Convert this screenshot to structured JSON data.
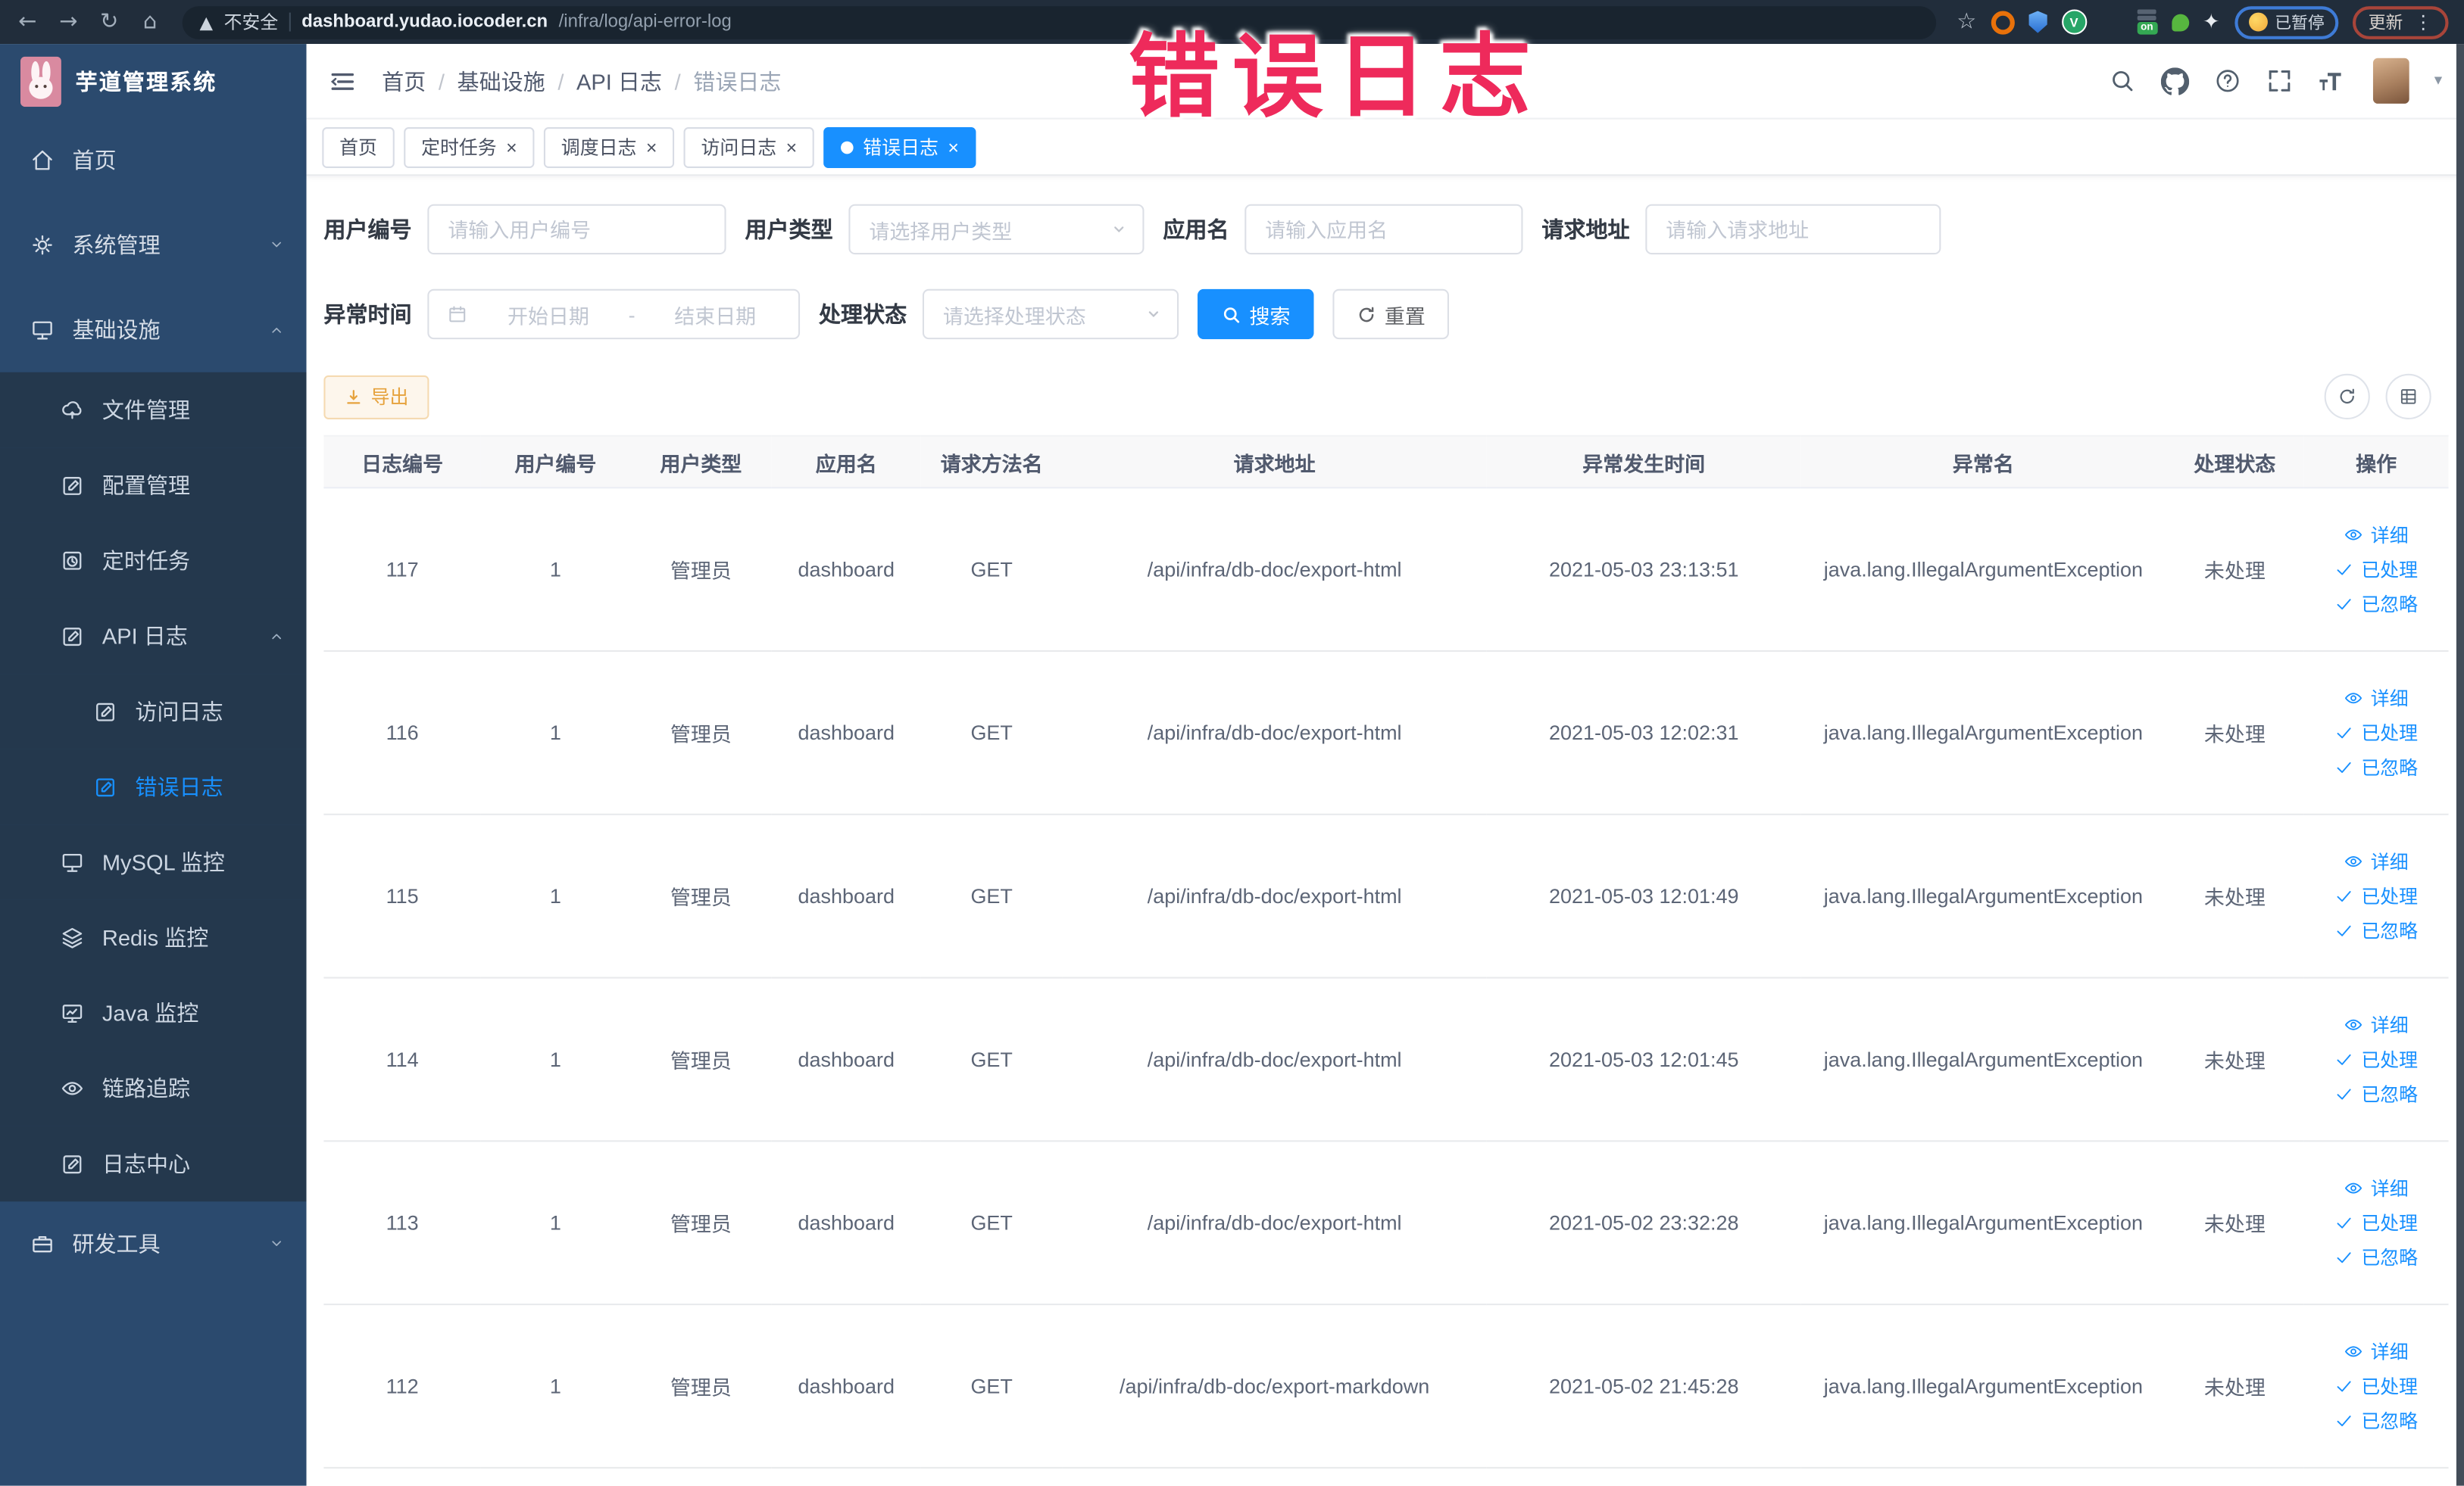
{
  "browser": {
    "security_label": "不安全",
    "url_host": "dashboard.yudao.iocoder.cn",
    "url_path": "/infra/log/api-error-log",
    "paused_badge_label": "已暂停",
    "update_badge_label": "更新"
  },
  "annotation_text": "错误日志",
  "sidebar": {
    "app_title": "芋道管理系统",
    "items": [
      {
        "label": "首页",
        "icon": "home-icon",
        "depth": 0
      },
      {
        "label": "系统管理",
        "icon": "gear-icon",
        "depth": 0,
        "chevron": "down"
      },
      {
        "label": "基础设施",
        "icon": "monitor-icon",
        "depth": 0,
        "chevron": "up"
      },
      {
        "label": "文件管理",
        "icon": "upload-cloud-icon",
        "depth": 1,
        "sub": true
      },
      {
        "label": "配置管理",
        "icon": "edit-square-icon",
        "depth": 1,
        "sub": true
      },
      {
        "label": "定时任务",
        "icon": "history-icon",
        "depth": 1,
        "sub": true
      },
      {
        "label": "API 日志",
        "icon": "edit-square-icon",
        "depth": 1,
        "sub": true,
        "chevron": "up"
      },
      {
        "label": "访问日志",
        "icon": "edit-square-icon",
        "depth": 2,
        "sub": true
      },
      {
        "label": "错误日志",
        "icon": "edit-square-icon",
        "depth": 2,
        "sub": true,
        "active": true
      },
      {
        "label": "MySQL 监控",
        "icon": "monitor-icon",
        "depth": 1,
        "sub": true
      },
      {
        "label": "Redis 监控",
        "icon": "layers-icon",
        "depth": 1,
        "sub": true
      },
      {
        "label": "Java 监控",
        "icon": "screen-chart-icon",
        "depth": 1,
        "sub": true
      },
      {
        "label": "链路追踪",
        "icon": "eye-icon",
        "depth": 1,
        "sub": true
      },
      {
        "label": "日志中心",
        "icon": "edit-square-icon",
        "depth": 1,
        "sub": true
      },
      {
        "label": "研发工具",
        "icon": "briefcase-icon",
        "depth": 0,
        "chevron": "down"
      }
    ]
  },
  "header": {
    "breadcrumb": [
      "首页",
      "基础设施",
      "API 日志",
      "错误日志"
    ]
  },
  "tabs": [
    {
      "label": "首页",
      "closable": false,
      "active": false
    },
    {
      "label": "定时任务",
      "closable": true,
      "active": false
    },
    {
      "label": "调度日志",
      "closable": true,
      "active": false
    },
    {
      "label": "访问日志",
      "closable": true,
      "active": false
    },
    {
      "label": "错误日志",
      "closable": true,
      "active": true
    }
  ],
  "filters": {
    "user_id": {
      "label": "用户编号",
      "placeholder": "请输入用户编号"
    },
    "user_type": {
      "label": "用户类型",
      "placeholder": "请选择用户类型"
    },
    "app_name": {
      "label": "应用名",
      "placeholder": "请输入应用名"
    },
    "request_url": {
      "label": "请求地址",
      "placeholder": "请输入请求地址"
    },
    "exception_time": {
      "label": "异常时间",
      "start_placeholder": "开始日期",
      "separator": "-",
      "end_placeholder": "结束日期"
    },
    "process_status": {
      "label": "处理状态",
      "placeholder": "请选择处理状态"
    },
    "search_label": "搜索",
    "reset_label": "重置"
  },
  "toolbar": {
    "export_label": "导出"
  },
  "table": {
    "columns": [
      "日志编号",
      "用户编号",
      "用户类型",
      "应用名",
      "请求方法名",
      "请求地址",
      "异常发生时间",
      "异常名",
      "处理状态",
      "操作"
    ],
    "row_keys": [
      "id",
      "user_id",
      "user_type",
      "app",
      "method",
      "url",
      "time",
      "exception",
      "status"
    ],
    "actions": [
      {
        "name": "detail",
        "label": "详细",
        "icon": "eye-icon"
      },
      {
        "name": "processed",
        "label": "已处理",
        "icon": "check-icon"
      },
      {
        "name": "ignored",
        "label": "已忽略",
        "icon": "check-icon"
      }
    ],
    "rows": [
      {
        "id": "117",
        "user_id": "1",
        "user_type": "管理员",
        "app": "dashboard",
        "method": "GET",
        "url": "/api/infra/db-doc/export-html",
        "time": "2021-05-03 23:13:51",
        "exception": "java.lang.IllegalArgumentException",
        "status": "未处理"
      },
      {
        "id": "116",
        "user_id": "1",
        "user_type": "管理员",
        "app": "dashboard",
        "method": "GET",
        "url": "/api/infra/db-doc/export-html",
        "time": "2021-05-03 12:02:31",
        "exception": "java.lang.IllegalArgumentException",
        "status": "未处理"
      },
      {
        "id": "115",
        "user_id": "1",
        "user_type": "管理员",
        "app": "dashboard",
        "method": "GET",
        "url": "/api/infra/db-doc/export-html",
        "time": "2021-05-03 12:01:49",
        "exception": "java.lang.IllegalArgumentException",
        "status": "未处理"
      },
      {
        "id": "114",
        "user_id": "1",
        "user_type": "管理员",
        "app": "dashboard",
        "method": "GET",
        "url": "/api/infra/db-doc/export-html",
        "time": "2021-05-03 12:01:45",
        "exception": "java.lang.IllegalArgumentException",
        "status": "未处理"
      },
      {
        "id": "113",
        "user_id": "1",
        "user_type": "管理员",
        "app": "dashboard",
        "method": "GET",
        "url": "/api/infra/db-doc/export-html",
        "time": "2021-05-02 23:32:28",
        "exception": "java.lang.IllegalArgumentException",
        "status": "未处理"
      },
      {
        "id": "112",
        "user_id": "1",
        "user_type": "管理员",
        "app": "dashboard",
        "method": "GET",
        "url": "/api/infra/db-doc/export-markdown",
        "time": "2021-05-02 21:45:28",
        "exception": "java.lang.IllegalArgumentException",
        "status": "未处理"
      }
    ]
  },
  "colors": {
    "primary": "#1890ff",
    "warning": "#e6a23c",
    "warning-bg": "#fdf6ec",
    "warning-border": "#f5dab1",
    "sidebar-bg": "#2b4a6e",
    "sidebar-submenu-bg": "#24384d",
    "annotation": "#ee2a5b",
    "browser-bar-bg": "#212d3b"
  }
}
